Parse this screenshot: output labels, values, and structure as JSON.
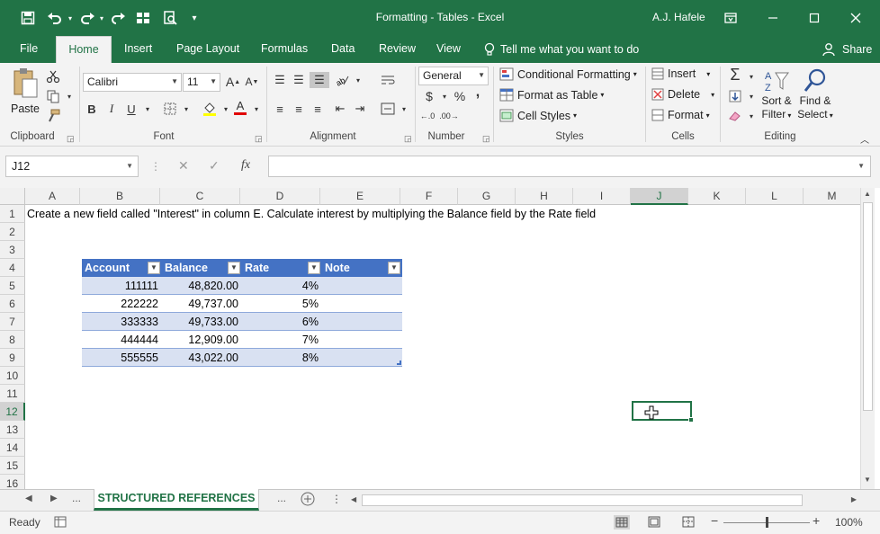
{
  "titlebar": {
    "title": "Formatting - Tables  -  Excel",
    "user": "A.J. Hafele",
    "qat_icons": [
      "save-icon",
      "undo-icon",
      "redo-icon",
      "redo-alt-icon",
      "form-icon",
      "print-preview-icon",
      "customize-qat-icon"
    ],
    "window_icons": [
      "ribbon-display-icon",
      "minimize-icon",
      "maximize-icon",
      "close-icon"
    ]
  },
  "tabs": {
    "items": [
      "File",
      "Home",
      "Insert",
      "Page Layout",
      "Formulas",
      "Data",
      "Review",
      "View"
    ],
    "active": "Home",
    "tell_me": "Tell me what you want to do",
    "share": "Share"
  },
  "ribbon": {
    "clipboard": {
      "label": "Clipboard",
      "paste": "Paste"
    },
    "font": {
      "label": "Font",
      "name": "Calibri",
      "size": "11",
      "bold": "B",
      "italic": "I",
      "underline": "U"
    },
    "alignment": {
      "label": "Alignment"
    },
    "number": {
      "label": "Number",
      "format": "General",
      "currency": "$",
      "percent": "%",
      "comma": ","
    },
    "styles": {
      "label": "Styles",
      "conditional": "Conditional Formatting",
      "format_table": "Format as Table",
      "cell_styles": "Cell Styles"
    },
    "cells": {
      "label": "Cells",
      "insert": "Insert",
      "delete": "Delete",
      "format": "Format"
    },
    "editing": {
      "label": "Editing",
      "sort": "Sort &",
      "filter": "Filter",
      "find": "Find &",
      "select": "Select"
    }
  },
  "formula_bar": {
    "name_box": "J12",
    "content": ""
  },
  "grid": {
    "columns": [
      "A",
      "B",
      "C",
      "D",
      "E",
      "F",
      "G",
      "H",
      "I",
      "J",
      "K",
      "L",
      "M"
    ],
    "selected_column": "J",
    "rows": [
      "1",
      "2",
      "3",
      "4",
      "5",
      "6",
      "7",
      "8",
      "9",
      "10",
      "11",
      "12",
      "13",
      "14",
      "15",
      "16"
    ],
    "selected_row": "12",
    "a1_text": "Create a new field called \"Interest\" in column E.  Calculate interest by multiplying the Balance field by the Rate field"
  },
  "table": {
    "headers": [
      "Account",
      "Balance",
      "Rate",
      "Note"
    ],
    "rows": [
      [
        "111111",
        "48,820.00",
        "4%",
        ""
      ],
      [
        "222222",
        "49,737.00",
        "5%",
        ""
      ],
      [
        "333333",
        "49,733.00",
        "6%",
        ""
      ],
      [
        "444444",
        "12,909.00",
        "7%",
        ""
      ],
      [
        "555555",
        "43,022.00",
        "8%",
        ""
      ]
    ],
    "header_color": "#4472c4",
    "band_color": "#d9e1f2"
  },
  "sheets": {
    "ellipsis_left": "...",
    "active": "STRUCTURED REFERENCES",
    "ellipsis_right": "..."
  },
  "status": {
    "ready": "Ready",
    "zoom": "100%",
    "zoom_level": 100
  },
  "colors": {
    "accent": "#217346"
  }
}
